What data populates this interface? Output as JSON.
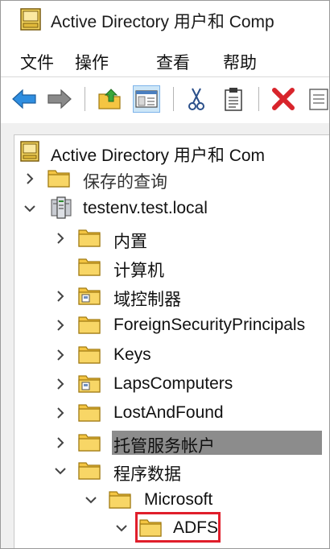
{
  "window": {
    "title": "Active Directory 用户和 Comp"
  },
  "menu": {
    "items": [
      "文件",
      "操作",
      "查看",
      "帮助"
    ]
  },
  "toolbar": {
    "buttons": [
      "back-arrow-icon",
      "forward-arrow-icon",
      "up-folder-icon",
      "show-hide-tree-icon",
      "cut-icon",
      "clipboard-icon",
      "delete-icon",
      "properties-icon"
    ]
  },
  "tree": {
    "root": "Active Directory 用户和 Com",
    "saved_queries": "保存的查询",
    "domain": "testenv.test.local",
    "builtin": "内置",
    "computers": "计算机",
    "domain_controllers": "域控制器",
    "foreign_security_principals": "ForeignSecurityPrincipals",
    "keys": "Keys",
    "laps_computers": "LapsComputers",
    "lost_and_found": "LostAndFound",
    "managed_service_accounts": "托管服务帐户",
    "program_data": "程序数据",
    "microsoft": "Microsoft",
    "adfs": "ADFS"
  },
  "colors": {
    "folder": "#f4c542",
    "selection_bar": "#8c8c8c",
    "highlight_box": "#e01e2b",
    "toolbar_pressed": "#cde6f7"
  }
}
